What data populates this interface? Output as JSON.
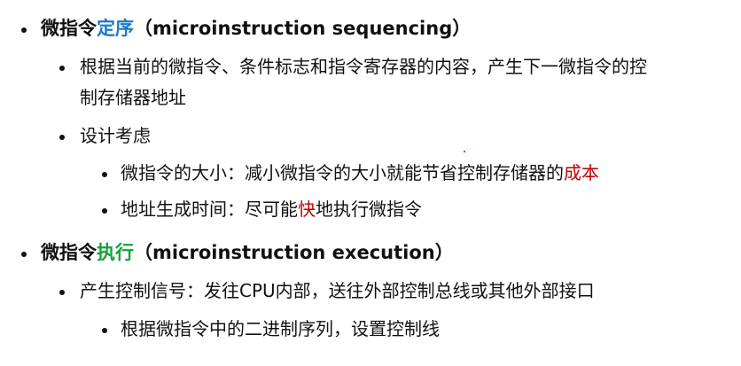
{
  "section1": {
    "title_prefix": "微指令",
    "title_highlight": "定序",
    "title_suffix": "（microinstruction sequencing）",
    "item1_line1": "根据当前的微指令、条件标志和指令寄存器的内容，产生下一微指令的控",
    "item1_line2": "制存储器地址",
    "item2": "设计考虑",
    "sub1_prefix": "微指令的大小：减小微指令的大小就能节省控制存储器的",
    "sub1_highlight": "成本",
    "sub2_prefix": "地址生成时间：尽可能",
    "sub2_highlight": "快",
    "sub2_suffix": "地执行微指令"
  },
  "section2": {
    "title_prefix": "微指令",
    "title_highlight": "执行",
    "title_suffix": "（microinstruction execution）",
    "item1": "产生控制信号：发往CPU内部，送往外部控制总线或其他外部接口",
    "sub1": "根据微指令中的二进制序列，设置控制线"
  },
  "colors": {
    "blue": "#1f78c8",
    "green": "#14a33a",
    "red": "#c00000",
    "text": "#111111"
  }
}
